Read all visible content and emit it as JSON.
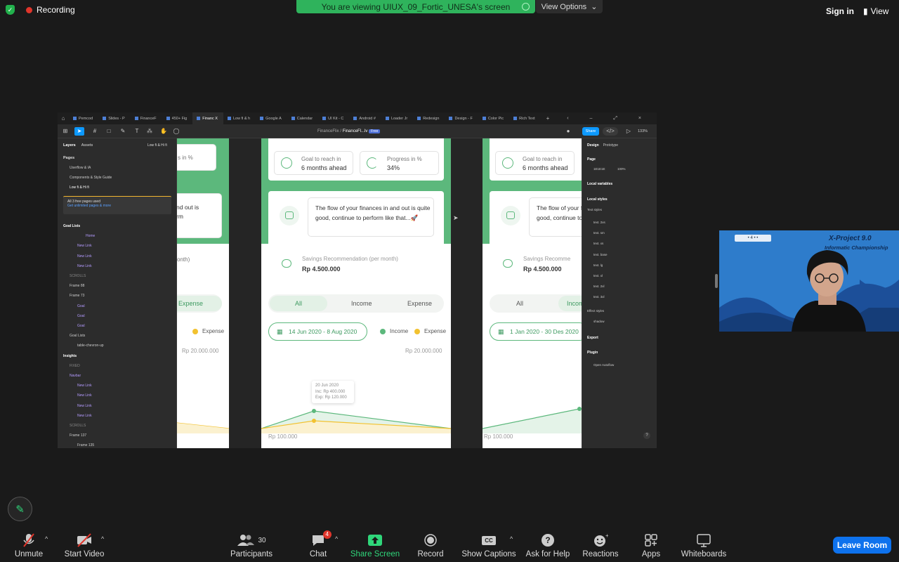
{
  "topbar": {
    "recording": "Recording",
    "viewing": "You are viewing UIUX_09_Fortic_UNESA's screen",
    "view_options": "View Options",
    "sign_in": "Sign in",
    "view": "View"
  },
  "figma": {
    "tabs": [
      "Pemcod",
      "Slides - P",
      "FinanceF",
      "450+ Fig",
      "Financ X",
      "Low fi & h",
      "Google A",
      "Calendar",
      "UI Kit - C",
      "Android #",
      "Loader Jr",
      "Redesign",
      "Design - F",
      "Color Pic",
      "Rich Text"
    ],
    "file_path": "FinanceFlix",
    "file_name": "FinanceFl...lv",
    "free_badge": "Free",
    "share": "Share",
    "zoom": "133%",
    "left": {
      "tab_layers": "Layers",
      "tab_assets": "Assets",
      "low_hifi": "Low fi & Hi fi",
      "pages": "Pages",
      "page_items": [
        "Userflow & IA",
        "Components & Style Guide",
        "Low fi & Hi fi"
      ],
      "upgrade_title": "All 3 free pages used",
      "upgrade_link": "Get unlimited pages & more",
      "layers": [
        "Goal Lists",
        "Home",
        "New Link",
        "New Link",
        "New Link",
        "SCROLLS",
        "Frame 88",
        "Frame 73",
        "Goal",
        "Goal",
        "Goal",
        "Goal Lists",
        "table-chevron-up",
        "Insights",
        "FIXED",
        "Navbar",
        "New Link",
        "New Link",
        "New Link",
        "New Link",
        "SCROLLS",
        "Frame 137",
        "Frame 135",
        "Frame 25"
      ]
    },
    "right": {
      "tab_design": "Design",
      "tab_prototype": "Prototype",
      "page": "Page",
      "page_color": "1E1E1E",
      "page_opacity": "100%",
      "local_variables": "Local variables",
      "local_styles": "Local styles",
      "text_styles": "Text styles",
      "styles": [
        "text. 2xs",
        "text. sm",
        "text. xs",
        "text. base",
        "text. lg",
        "text. xl",
        "text. 2xl",
        "text. 3xl"
      ],
      "effect_styles": "Effect styles",
      "shadow": "shadow",
      "export": "Export",
      "plugin": "Plugin",
      "plugin_name": "Open Autoflow"
    },
    "frames": {
      "goal_label": "Goal to reach in",
      "goal_value": "6 months ahead",
      "progress_label": "Progress in %",
      "progress_value": "34%",
      "message": "The flow of your finances in and out is quite good, continue to perform like that...🚀",
      "savings_label": "Savings Recommendation (per month)",
      "savings_value": "Rp 4.500.000",
      "filter": [
        "All",
        "Income",
        "Expense"
      ],
      "date_range_1": "14 Jun 2020 - 8 Aug 2020",
      "date_range_2": "1 Jan 2020 - 30 Des 2020",
      "legend_income": "Income",
      "legend_expense": "Expense",
      "y_top": "Rp 20.000.000",
      "y_bottom": "Rp 100.000",
      "tooltip_date": "20 Jun 2020",
      "tooltip_inc": "Inc: Rp 400.000",
      "tooltip_exp": "Exp: Rp 120.000",
      "left_partial_1": "s in %",
      "left_partial_2": "nd out is",
      "left_partial_3": "rm",
      "left_partial_4": "onth)",
      "left_expense": "Expense",
      "right_savings_partial": "Savings Recomme",
      "right_filter_partial": "Incom"
    },
    "colors": {
      "green": "#5cb87c",
      "yellow": "#f2c230",
      "blue": "#0d99ff"
    }
  },
  "camera": {
    "title": "X-Project 9.0",
    "subtitle": "Informatic Championship",
    "logo": "• 4 • •"
  },
  "bottom": {
    "unmute": "Unmute",
    "start_video": "Start Video",
    "participants": "Participants",
    "participants_count": "30",
    "chat": "Chat",
    "chat_badge": "4",
    "share_screen": "Share Screen",
    "record": "Record",
    "show_captions": "Show Captions",
    "cc": "CC",
    "ask_help": "Ask for Help",
    "reactions": "Reactions",
    "apps": "Apps",
    "whiteboards": "Whiteboards",
    "leave": "Leave Room"
  }
}
